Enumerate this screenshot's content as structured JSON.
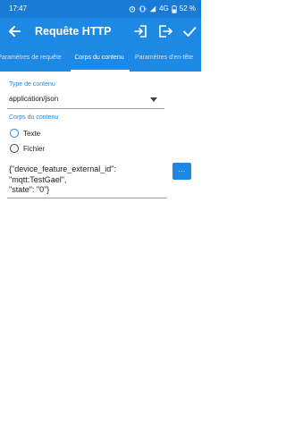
{
  "status_bar": {
    "time": "17:47",
    "network": "4G",
    "battery": "52 %",
    "icons": [
      "alarm-icon",
      "vibrate-icon",
      "signal-icon",
      "battery-icon"
    ]
  },
  "app_bar": {
    "title": "Requête HTTP",
    "actions": [
      "back-arrow-icon",
      "import-icon",
      "export-icon",
      "check-icon"
    ]
  },
  "tabs": [
    {
      "label": "Paramètres de requête",
      "selected": false
    },
    {
      "label": "Corps du contenu",
      "selected": true
    },
    {
      "label": "Paramètres d'en-tête",
      "selected": false
    }
  ],
  "content_type": {
    "label": "Type de contenu",
    "value": "application/json"
  },
  "content_body": {
    "label": "Corps du contenu",
    "options": [
      {
        "label": "Texte",
        "selected": true
      },
      {
        "label": "Fichier",
        "selected": false
      }
    ],
    "text_lines": [
      "{\"device_feature_external_id\":",
      "\"mqtt:TestGael\",",
      "\"state\": \"0\"}"
    ],
    "more_button": "..."
  },
  "colors": {
    "accent": "#1e88e5",
    "status_bar": "#1a7bd6",
    "background": "#ffffff",
    "text": "#212121"
  }
}
